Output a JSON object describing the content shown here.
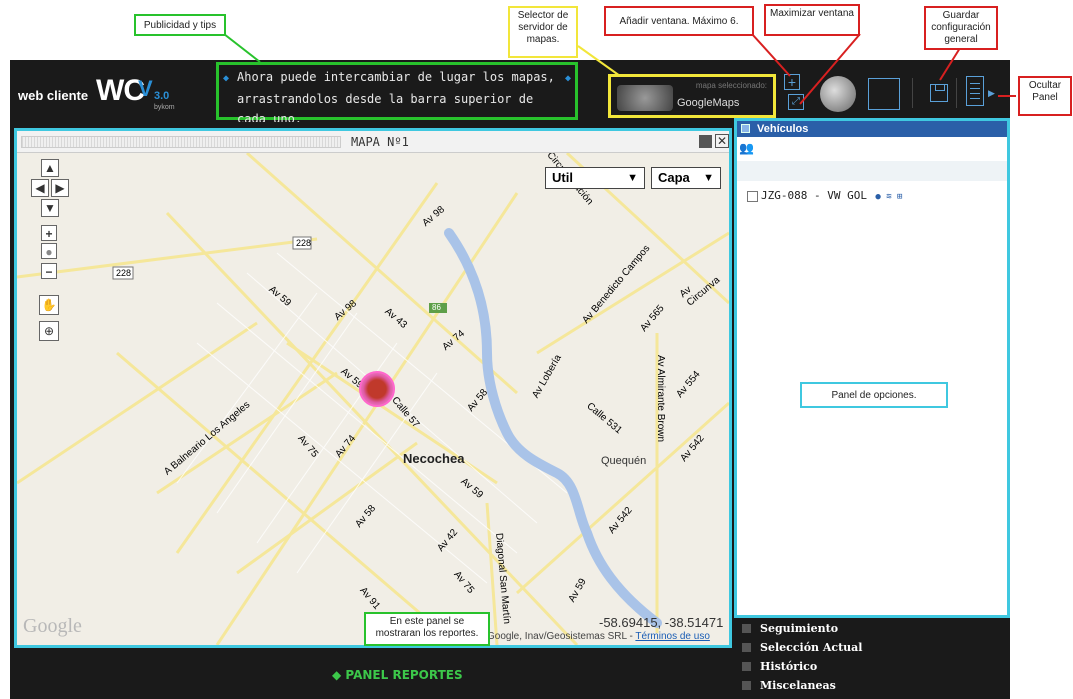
{
  "brand": {
    "small": "web cliente",
    "big": "WC",
    "v": "V",
    "version": "3.0",
    "sub": "bykom"
  },
  "tips": {
    "line1": "Ahora puede intercambiar de lugar los mapas,",
    "line2": "arrastrandolos desde la barra superior de cada uno."
  },
  "map_selector": {
    "label": "mapa seleccionado:",
    "value": "GoogleMaps"
  },
  "map_window": {
    "title": "MAPA Nº1",
    "dropdown_util": "Util",
    "dropdown_capa": "Capa",
    "coords": "-58.69415, -38.51471",
    "attribution": "Google, Inav/Geosistemas SRL - ",
    "terms": "Términos de uso",
    "google_logo": "Google",
    "labels": {
      "r228a": "228",
      "r228b": "228",
      "r86": "86",
      "av98a": "Av 98",
      "av98b": "Av 98",
      "av59a": "Av 59",
      "av59b": "Av 59",
      "av59c": "Av 59",
      "av59d": "Av 59",
      "av43": "Av 43",
      "av74a": "Av 74",
      "av74b": "Av 74",
      "av75a": "Av 75",
      "av75b": "Av 75",
      "av58a": "Av 58",
      "av58b": "Av 58",
      "av42": "Av 42",
      "av91": "Av 91",
      "av542a": "Av 542",
      "av542b": "Av 542",
      "av554": "Av 554",
      "av565": "Av 565",
      "calle57": "Calle 57",
      "calle531": "Calle 531",
      "benedicto": "Av Benedicto Campos",
      "almirante": "Av Almirante Brown",
      "loberia": "Av Lobería",
      "balneario": "A Balneario Los Angeles",
      "diagonal": "Diagonal San Martín",
      "circunv": "Av Circunva",
      "circ": "Circunvalación",
      "necochea": "Necochea",
      "quequen": "Quequén"
    }
  },
  "reports": {
    "label": "PANEL REPORTES"
  },
  "right_panel": {
    "header": "Vehículos",
    "vehicle": "JZG-088 - VW GOL",
    "accordion": [
      "Seguimiento",
      "Selección Actual",
      "Histórico",
      "Miscelaneas"
    ]
  },
  "annotations": {
    "publicidad": "Publicidad y tips",
    "selector": "Selector de servidor de mapas.",
    "anadir": "Añadir ventana. Máximo 6.",
    "maximizar": "Maximizar ventana",
    "guardar": "Guardar configuración general",
    "ocultar": "Ocultar Panel",
    "opciones": "Panel de opciones.",
    "reportes": "En este panel se mostraran los reportes."
  },
  "colors": {
    "green": "#28c22c",
    "yellow": "#f2e63a",
    "red": "#d82020",
    "cyan": "#3fc8e0",
    "blue": "#2a5fa8",
    "report_green": "#3cc84a"
  },
  "icons": [
    "map-pan-icon",
    "zoom-in-icon",
    "zoom-out-icon",
    "hand-icon",
    "magnify-icon",
    "globe-icon",
    "save-icon",
    "close-icon",
    "hide-panel-icon",
    "vehicle-car-icon"
  ]
}
